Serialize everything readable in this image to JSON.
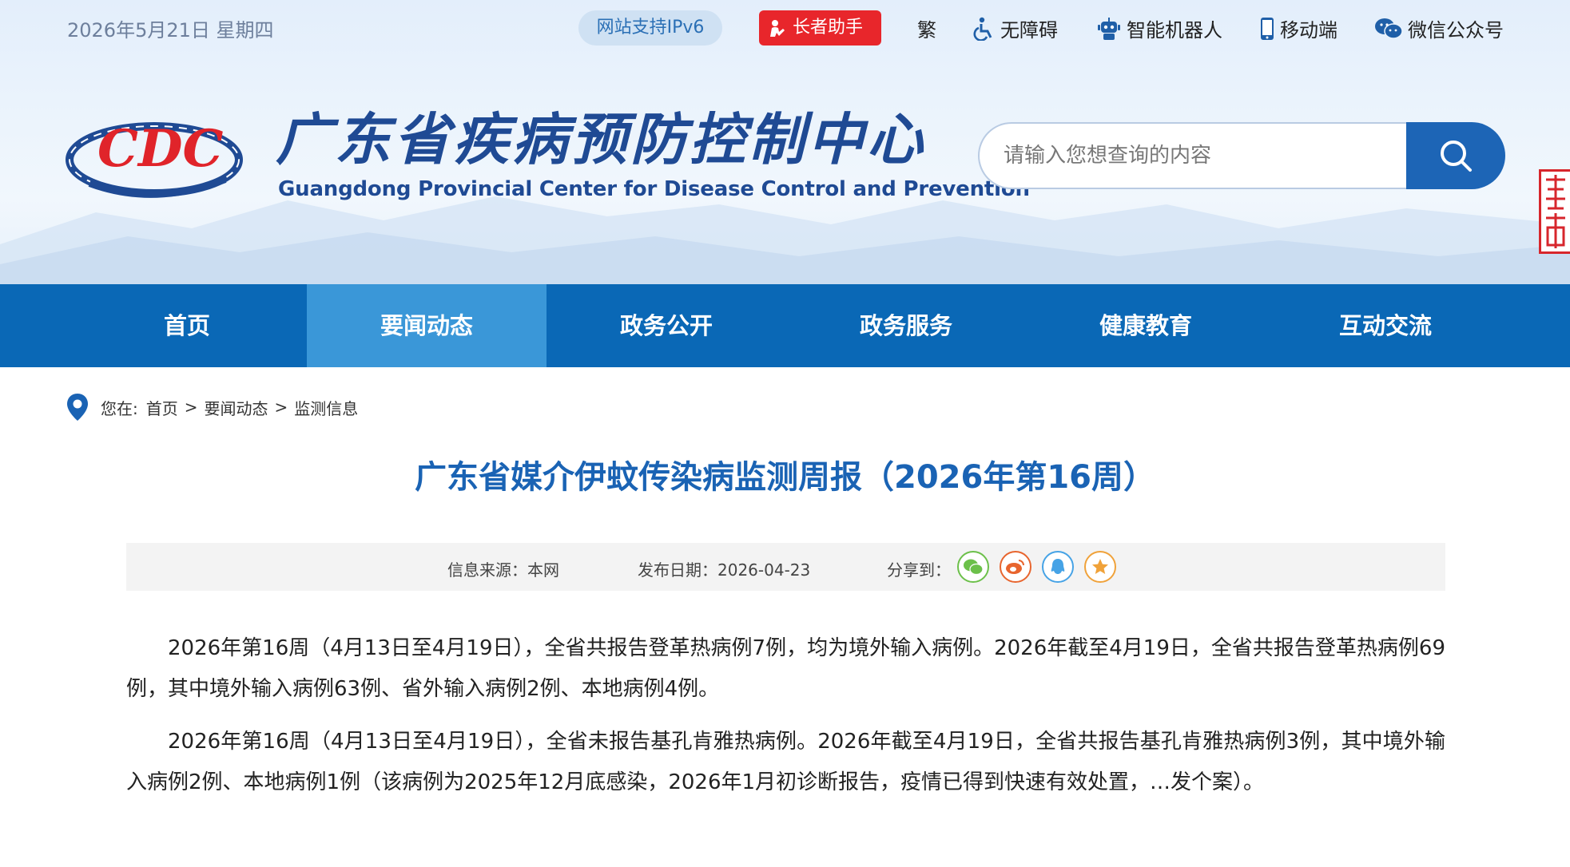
{
  "topbar": {
    "date": "2026年5月21日 星期四",
    "ipv6": "网站支持IPv6",
    "elder": "长者助手",
    "traditional": "繁",
    "accessibility": "无障碍",
    "robot": "智能机器人",
    "mobile": "移动端",
    "wechat": "微信公众号"
  },
  "header": {
    "logo_text": "CDC",
    "title_cn": "广东省疾病预防控制中心",
    "title_en": "Guangdong Provincial Center for Disease Control and Prevention",
    "search_placeholder": "请输入您想查询的内容"
  },
  "nav": {
    "items": [
      "首页",
      "要闻动态",
      "政务公开",
      "政务服务",
      "健康教育",
      "互动交流"
    ],
    "active": "要闻动态"
  },
  "breadcrumb": {
    "prefix": "您在:",
    "items": [
      "首页",
      "要闻动态",
      "监测信息"
    ],
    "separator": ">"
  },
  "article": {
    "title": "广东省媒介伊蚊传染病监测周报（2026年第16周）",
    "source": "信息来源：本网",
    "date": "发布日期：2026-04-23",
    "share_label": "分享到：",
    "paragraphs": [
      "2026年第16周（4月13日至4月19日），全省共报告登革热病例7例，均为境外输入病例。2026年截至4月19日，全省共报告登革热病例69例，其中境外输入病例63例、省外输入病例2例、本地病例4例。",
      "2026年第16周（4月13日至4月19日），全省未报告基孔肯雅热病例。2026年截至4月19日，全省共报告基孔肯雅热病例3例，其中境外输入病例2例、本地病例1例（该病例为2025年12月底感染，2026年1月初诊断报告，疫情已得到快速有效处置，…发个案）。"
    ]
  },
  "colors": {
    "nav": "#0a68b6",
    "nav_active": "#3a97d8",
    "title": "#1a63b4",
    "elder": "#e8262b"
  }
}
